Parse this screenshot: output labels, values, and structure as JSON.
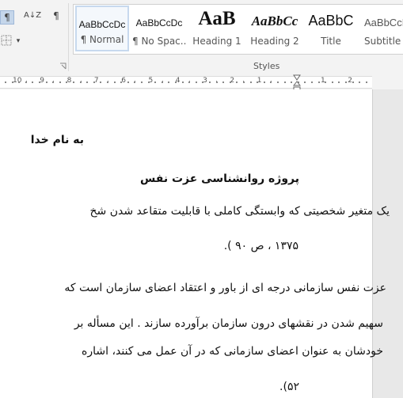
{
  "ribbon": {
    "paragraph_tools": {
      "show_marks_icon": "¶",
      "sort_icon": "A↓Z",
      "pilcrow_icon": "¶",
      "borders_dropdown_icon": "▾"
    },
    "styles_group_label": "Styles",
    "styles": [
      {
        "sample": "AaBbCcDc",
        "name": "¶ Normal",
        "selected": true
      },
      {
        "sample": "AaBbCcDc",
        "name": "¶ No Spac..."
      },
      {
        "sample": "AaB",
        "name": "Heading 1"
      },
      {
        "sample": "AaBbCc",
        "name": "Heading 2"
      },
      {
        "sample": "AaBbC",
        "name": "Title"
      },
      {
        "sample": "AaBbCcDc",
        "name": "Subtitle"
      }
    ]
  },
  "ruler": {
    "labels_left": [
      "10",
      "9",
      "8",
      "7",
      "6",
      "5",
      "4",
      "3",
      "2",
      "1"
    ],
    "labels_right": [
      "1",
      "2"
    ]
  },
  "document": {
    "lines": [
      "به نام خدا",
      "پروژه روانشناسی عزت نفس",
      "یک متغیر شخصیتی که وابستگی کاملی با قابلیت متقاعد شدن شخ",
      "۱۳۷۵ ، ص ۹۰ ).",
      "عزت نفس سازمانی درجه ای از باور و اعتقاد اعضای سازمان است که",
      "سهیم شدن در نقشهای درون سازمان برآورده سازند . این مسأله بر",
      "خودشان به عنوان اعضای سازمانی که در آن عمل می کنند، اشاره",
      "۵۲)."
    ]
  },
  "colors": {
    "ribbon_bg": "#f3f3f3",
    "selected_style_border": "#c7d9ee",
    "page_bg": "#ffffff"
  }
}
